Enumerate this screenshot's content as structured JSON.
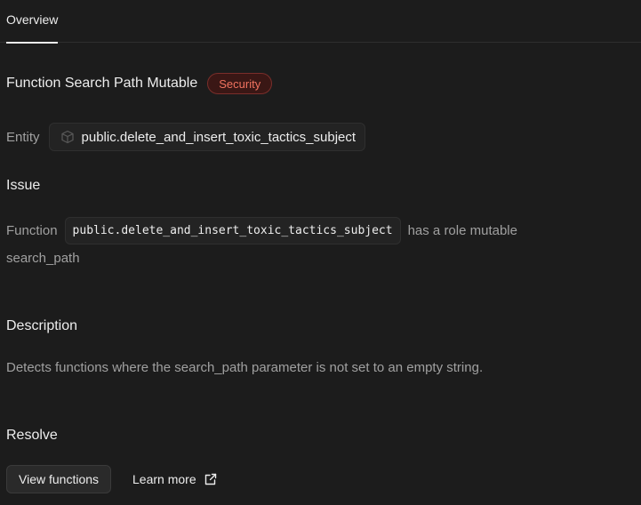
{
  "tabs": [
    {
      "label": "Overview",
      "active": true
    }
  ],
  "lint": {
    "title": "Function Search Path Mutable",
    "badge": "Security",
    "entity_label": "Entity",
    "entity_value": "public.delete_and_insert_toxic_tactics_subject",
    "entity_icon": "cube-icon"
  },
  "issue": {
    "heading": "Issue",
    "prefix": "Function",
    "code": "public.delete_and_insert_toxic_tactics_subject",
    "suffix": "has a role mutable",
    "line2": "search_path"
  },
  "description": {
    "heading": "Description",
    "text": "Detects functions where the search_path parameter is not set to an empty string."
  },
  "resolve": {
    "heading": "Resolve",
    "view_button": "View functions",
    "learn_more": "Learn more",
    "learn_more_icon": "external-link-icon"
  },
  "colors": {
    "background": "#1c1c1c",
    "text": "#ededed",
    "muted": "#a0a0a0",
    "badge_text": "#f0725f",
    "badge_bg": "#3a1715",
    "badge_border": "#7a2e2a"
  }
}
